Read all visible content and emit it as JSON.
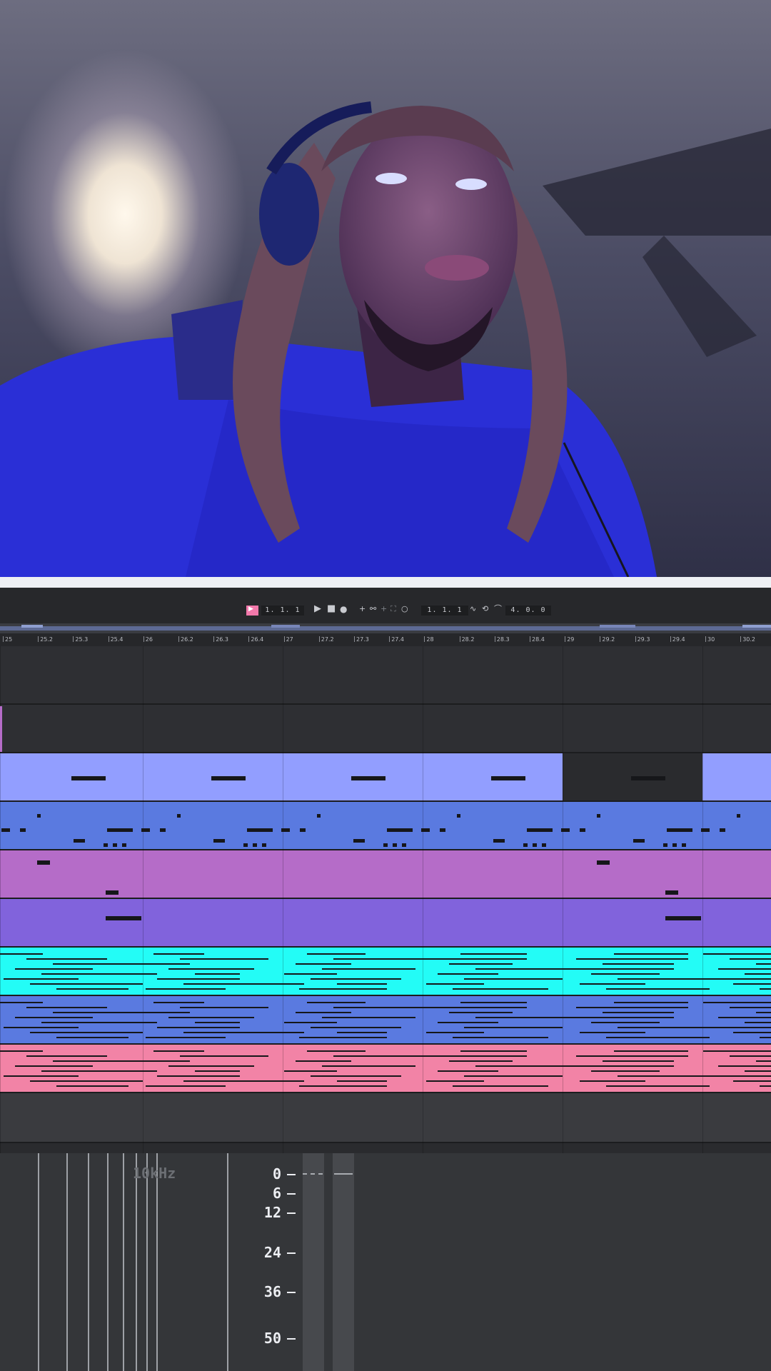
{
  "colors": {
    "periwinkle": "#929eff",
    "blue": "#5a7ae0",
    "orchid": "#b56cc8",
    "violet": "#8163dc",
    "cyan": "#23fcf6",
    "pink": "#f283a6",
    "empty": "#2e2f33"
  },
  "transport": {
    "position": "1. 1. 1",
    "loop_start": "1. 1. 1",
    "loop_length": "4. 0. 0"
  },
  "ruler": {
    "ticks": [
      "25",
      "25.2",
      "25.3",
      "25.4",
      "26",
      "26.2",
      "26.3",
      "26.4",
      "27",
      "27.2",
      "27.3",
      "27.4",
      "28",
      "28.2",
      "28.3",
      "28.4",
      "29",
      "29.2",
      "29.3",
      "29.4",
      "30",
      "30.2"
    ]
  },
  "meter": {
    "freq_label": "10kHz",
    "db_scale": [
      "0",
      "6",
      "12",
      "24",
      "36",
      "50"
    ]
  }
}
